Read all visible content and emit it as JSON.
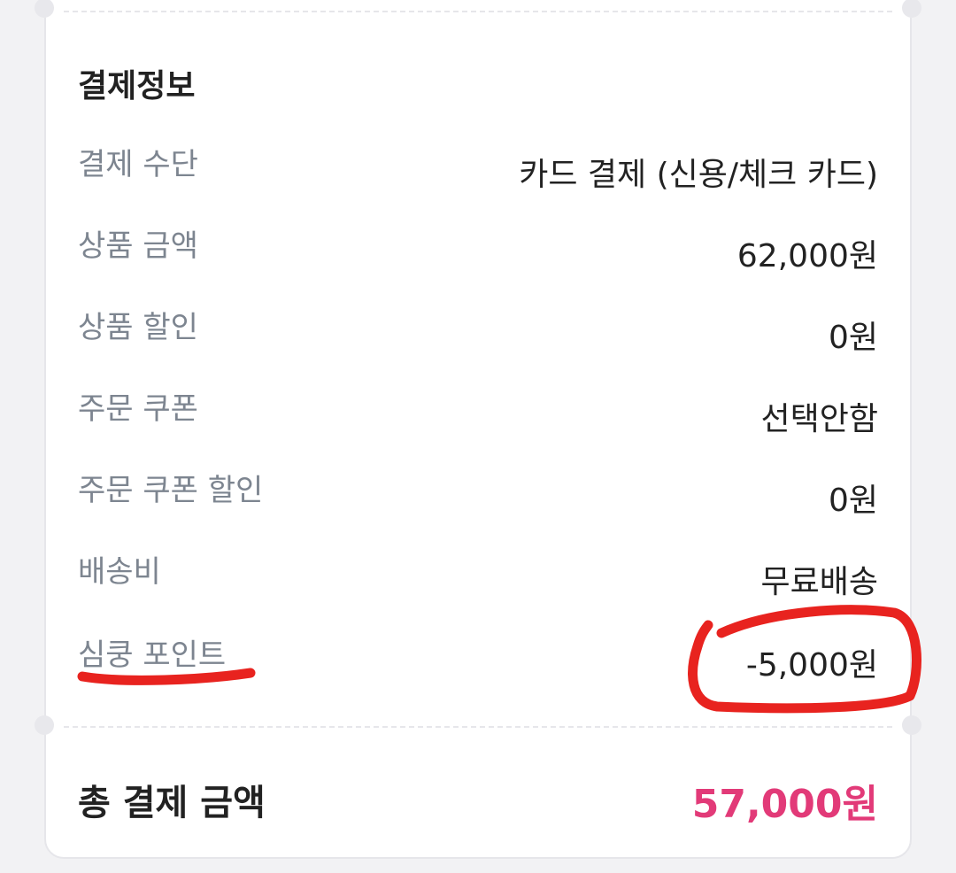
{
  "payment_info": {
    "title": "결제정보",
    "rows": [
      {
        "label": "결제 수단",
        "value": "카드 결제 (신용/체크 카드)"
      },
      {
        "label": "상품 금액",
        "value": "62,000원"
      },
      {
        "label": "상품 할인",
        "value": "0원"
      },
      {
        "label": "주문 쿠폰",
        "value": "선택안함"
      },
      {
        "label": "주문 쿠폰 할인",
        "value": "0원"
      },
      {
        "label": "배송비",
        "value": "무료배송"
      },
      {
        "label": "심쿵 포인트",
        "value": "-5,000원"
      }
    ]
  },
  "total": {
    "label": "총 결제 금액",
    "value": "57,000원"
  },
  "colors": {
    "total_accent": "#e23a78",
    "annotation_red": "#e8231f",
    "label_gray": "#7d8590",
    "text_dark": "#222222"
  }
}
